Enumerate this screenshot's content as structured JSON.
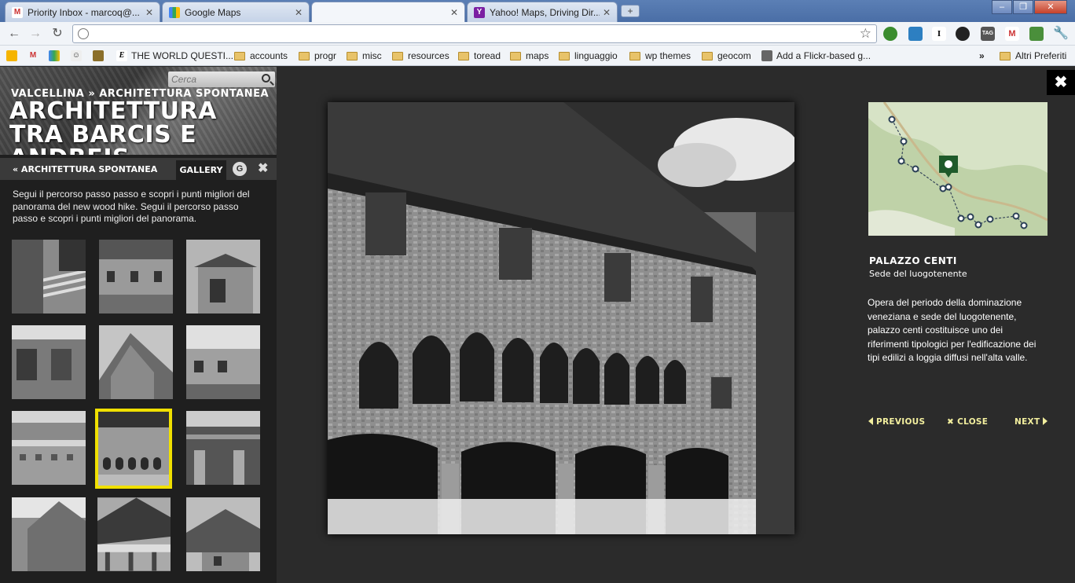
{
  "browser": {
    "tabs": [
      {
        "title": "Priority Inbox - marcoq@...",
        "icon": "gmail-icon"
      },
      {
        "title": "Google Maps",
        "icon": "google-maps-icon"
      },
      {
        "title": "",
        "icon": ""
      },
      {
        "title": "Yahoo! Maps, Driving Dir...",
        "icon": "yahoo-icon"
      }
    ],
    "bookmarks": [
      {
        "label": "THE WORLD QUESTI...",
        "type": "site"
      },
      {
        "label": "accounts",
        "type": "folder"
      },
      {
        "label": "progr",
        "type": "folder"
      },
      {
        "label": "misc",
        "type": "folder"
      },
      {
        "label": "resources",
        "type": "folder"
      },
      {
        "label": "toread",
        "type": "folder"
      },
      {
        "label": "maps",
        "type": "folder"
      },
      {
        "label": "linguaggio",
        "type": "folder"
      },
      {
        "label": "wp themes",
        "type": "folder"
      },
      {
        "label": "geocom",
        "type": "folder"
      },
      {
        "label": "Add a Flickr-based g...",
        "type": "site"
      }
    ],
    "other_bookmarks": "Altri Preferiti",
    "chevron": "»"
  },
  "sidebar": {
    "search_placeholder": "Cerca",
    "breadcrumb": "VALCELLINA » ARCHITETTURA SPONTANEA",
    "title": "ARCHITETTURA TRA BARCIS E ANDREIS",
    "back_link": "« ARCHITETTURA SPONTANEA",
    "gallery_tab": "GALLERY",
    "g_button": "G",
    "close_glyph": "✖",
    "intro": "Segui il percorso passo passo e scopri i punti migliori del panorama del new wood hike. Segui il percorso passo passo e scopri i punti migliori del panorama."
  },
  "viewer": {
    "close_glyph": "✖",
    "info_title": "PALAZZO CENTI",
    "info_subtitle": "Sede del luogotenente",
    "info_text": "Opera del periodo della dominazione veneziana e sede del luogotenente, palazzo centi costituisce uno dei riferimenti tipologici per l'edificazione dei tipi edilizi a loggia diffusi nell'alta valle.",
    "previous": "PREVIOUS",
    "close": "CLOSE",
    "next": "NEXT",
    "pager_color": "#f2ee9e",
    "selected_thumb_color": "#f0e000"
  }
}
